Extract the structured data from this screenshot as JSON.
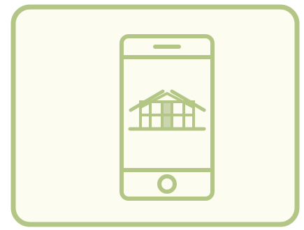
{
  "colors": {
    "background": "#fdfcf0",
    "accent": "#b3c686",
    "accent_fill": "#cbd6ae"
  },
  "card": {
    "icon": "smartphone-icon"
  },
  "phone": {
    "icon": "smartphone-icon",
    "speaker": "speaker-slot-icon",
    "home_button": "home-button-icon"
  },
  "screen_content": {
    "icon": "house-icon"
  }
}
